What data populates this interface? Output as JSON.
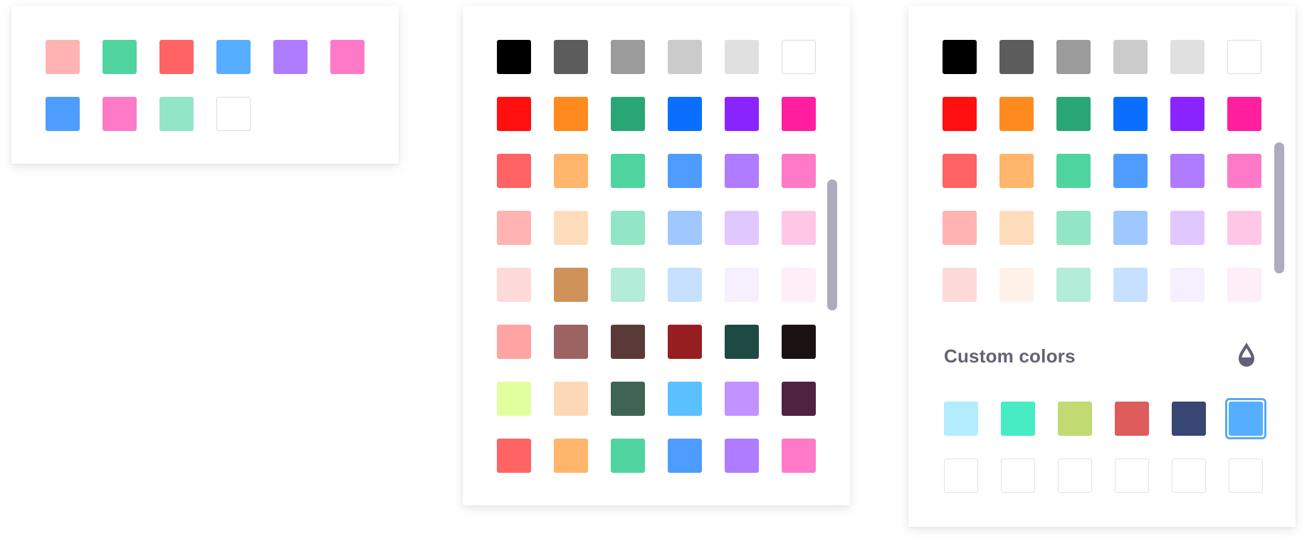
{
  "panels": [
    {
      "name": "compact-palette",
      "rows": [
        [
          "#ffb3b3",
          "#4fd49f",
          "#ff6363",
          "#55aeff",
          "#b07cff",
          "#ff7ac6"
        ],
        [
          "#4f9cff",
          "#ff7ac6",
          "#92e6c6",
          "#ffffff"
        ]
      ]
    },
    {
      "name": "full-palette",
      "rows": [
        [
          "#000000",
          "#5c5c5c",
          "#9b9b9b",
          "#cbcbcb",
          "#e0e0e0",
          "#ffffff"
        ],
        [
          "#ff0f0f",
          "#ff8a1e",
          "#29a676",
          "#0a6fff",
          "#8a24ff",
          "#ff1f9e"
        ],
        [
          "#ff6363",
          "#ffb56b",
          "#4fd49f",
          "#4f9cff",
          "#b07cff",
          "#ff7ac6"
        ],
        [
          "#ffb3b3",
          "#ffdcbc",
          "#92e6c6",
          "#a0c8ff",
          "#e0c8ff",
          "#ffc6e6"
        ],
        [
          "#ffdada",
          "#cf935a",
          "#b3ecd8",
          "#c8e0ff",
          "#f5effe",
          "#fdeef7"
        ],
        [
          "#ffa3a3",
          "#9b6462",
          "#5a3a38",
          "#961e21",
          "#1e4a44",
          "#1a1212"
        ],
        [
          "#e2ff9f",
          "#fdd8b6",
          "#3f6453",
          "#5ac0ff",
          "#c292ff",
          "#4e2240"
        ],
        [
          "#ff6363",
          "#ffb56b",
          "#4fd49f",
          "#4f9cff",
          "#b07cff",
          "#ff7ac6"
        ]
      ]
    },
    {
      "name": "palette-with-custom",
      "rows": [
        [
          "#000000",
          "#5c5c5c",
          "#9b9b9b",
          "#cbcbcb",
          "#e0e0e0",
          "#ffffff"
        ],
        [
          "#ff0f0f",
          "#ff8a1e",
          "#29a676",
          "#0a6fff",
          "#8a24ff",
          "#ff1f9e"
        ],
        [
          "#ff6363",
          "#ffb56b",
          "#4fd49f",
          "#4f9cff",
          "#b07cff",
          "#ff7ac6"
        ],
        [
          "#ffb3b3",
          "#ffdcbc",
          "#92e6c6",
          "#a0c8ff",
          "#e0c8ff",
          "#ffc6e6"
        ],
        [
          "#ffdada",
          "#fef1e7",
          "#b3ecd8",
          "#c8e0ff",
          "#f5effe",
          "#fdeef7"
        ]
      ],
      "custom_colors": {
        "title": "Custom colors",
        "icon": "eyedropper-icon",
        "colors": [
          "#b3ecff",
          "#47ecc4",
          "#c1da72",
          "#de5c5c",
          "#374672",
          "#55aeff"
        ],
        "selected_index": 5,
        "empty_slots": 6
      }
    }
  ],
  "accent_color": "#5aa9ee",
  "text_color": "#626274",
  "scrollbar_color": "#acacbc"
}
